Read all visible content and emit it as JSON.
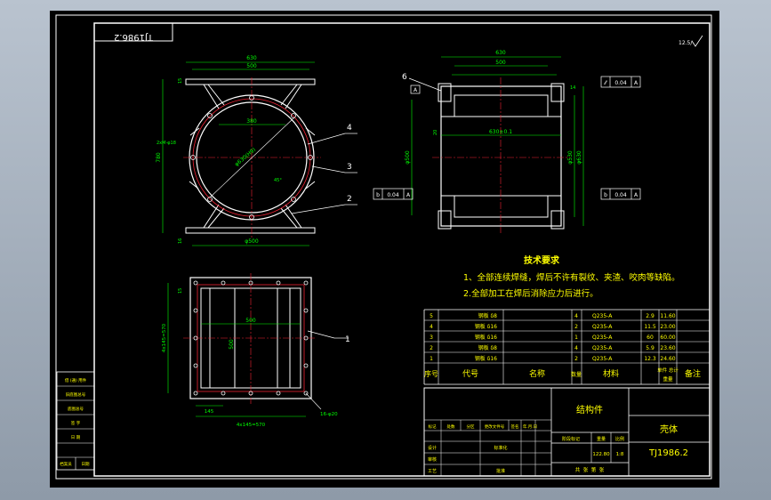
{
  "drawing_code_rotated": "TJ1986.2",
  "surface_finish": "12.5/",
  "tech_req": {
    "title": "技术要求",
    "line1": "1、全部连续焊缝，焊后不许有裂纹、夹渣、咬肉等缺陷。",
    "line2": "2.全部加工在焊后消除应力后进行。"
  },
  "top_view": {
    "dim_top_outer": "630",
    "dim_top_inner": "500",
    "dim_inner_circle": "380",
    "dim_bottom": "φ500",
    "dim_left": "780",
    "dim_side_small_top": "15",
    "dim_side_small_bot": "16",
    "hole_note": "2xM-φ18",
    "diameter_note": "φ630(H9)",
    "angle_note": "45°"
  },
  "side_view": {
    "dim_top_outer": "630",
    "dim_top_inner": "500",
    "dim_center": "630±0.1",
    "dim_left_vert": "φ500",
    "dim_right_1": "φ630",
    "dim_right_2": "φ530",
    "dim_right_small": "14",
    "dim_left_small": "20",
    "fcf_top_sym": "⁄⁄",
    "fcf_top_val": "0.04",
    "fcf_top_datum": "A",
    "fcf_left_sym": "b",
    "fcf_left_val": "0.04",
    "fcf_left_datum": "A",
    "fcf_right_sym": "b",
    "fcf_right_val": "0.04",
    "fcf_right_datum": "A",
    "datum_label": "A"
  },
  "bottom_view": {
    "dim_left_vert": "4x145=570",
    "dim_top_small": "15",
    "dim_inner": "500",
    "dim_inner_vert": "500",
    "dim_bottom_small": "145",
    "dim_bottom_total": "4x145=570",
    "hole_note": "16-φ20"
  },
  "callouts": [
    "6",
    "4",
    "3",
    "2",
    "1"
  ],
  "bom": {
    "rows": [
      {
        "no": "5",
        "code": "",
        "name": "钢板 δ8",
        "qty": "4",
        "material": "Q235-A",
        "unit_wt": "2.9",
        "total_wt": "11.60"
      },
      {
        "no": "4",
        "code": "",
        "name": "钢板 δ16",
        "qty": "2",
        "material": "Q235-A",
        "unit_wt": "11.5",
        "total_wt": "23.00"
      },
      {
        "no": "3",
        "code": "",
        "name": "钢板 δ16",
        "qty": "1",
        "material": "Q235-A",
        "unit_wt": "60",
        "total_wt": "60.00"
      },
      {
        "no": "2",
        "code": "",
        "name": "钢板 δ8",
        "qty": "4",
        "material": "Q235-A",
        "unit_wt": "5.9",
        "total_wt": "23.60"
      },
      {
        "no": "1",
        "code": "",
        "name": "钢板 δ16",
        "qty": "2",
        "material": "Q235-A",
        "unit_wt": "12.3",
        "total_wt": "24.60"
      }
    ],
    "headers": {
      "no": "序号",
      "code": "代号",
      "name": "名称",
      "qty": "数量",
      "material": "材料",
      "weight_top": "单件 总计",
      "weight_bot": "重量",
      "note": "备注"
    }
  },
  "title_block": {
    "group": "结构件",
    "part_name": "壳体",
    "drawing_no": "TJ1986.2",
    "mark_cols": [
      "标记",
      "处数",
      "分区",
      "更改文件号",
      "签名",
      "年.月.日"
    ],
    "design": "设计",
    "standardize": "标准化",
    "review": "审核",
    "process": "工艺",
    "approve": "批准",
    "stage_mark": "阶段标记",
    "weight": "重量",
    "scale": "比例",
    "weight_val": "122.80",
    "scale_val": "1:8",
    "sheets": "共  张  第  张"
  },
  "left_strip": {
    "r1": "借 (通) 用件",
    "r2": "旧底图总号",
    "r3": "底图总号",
    "r4": "签  字",
    "r5": "日  期",
    "r6a": "档案员",
    "r6b": "日期"
  }
}
